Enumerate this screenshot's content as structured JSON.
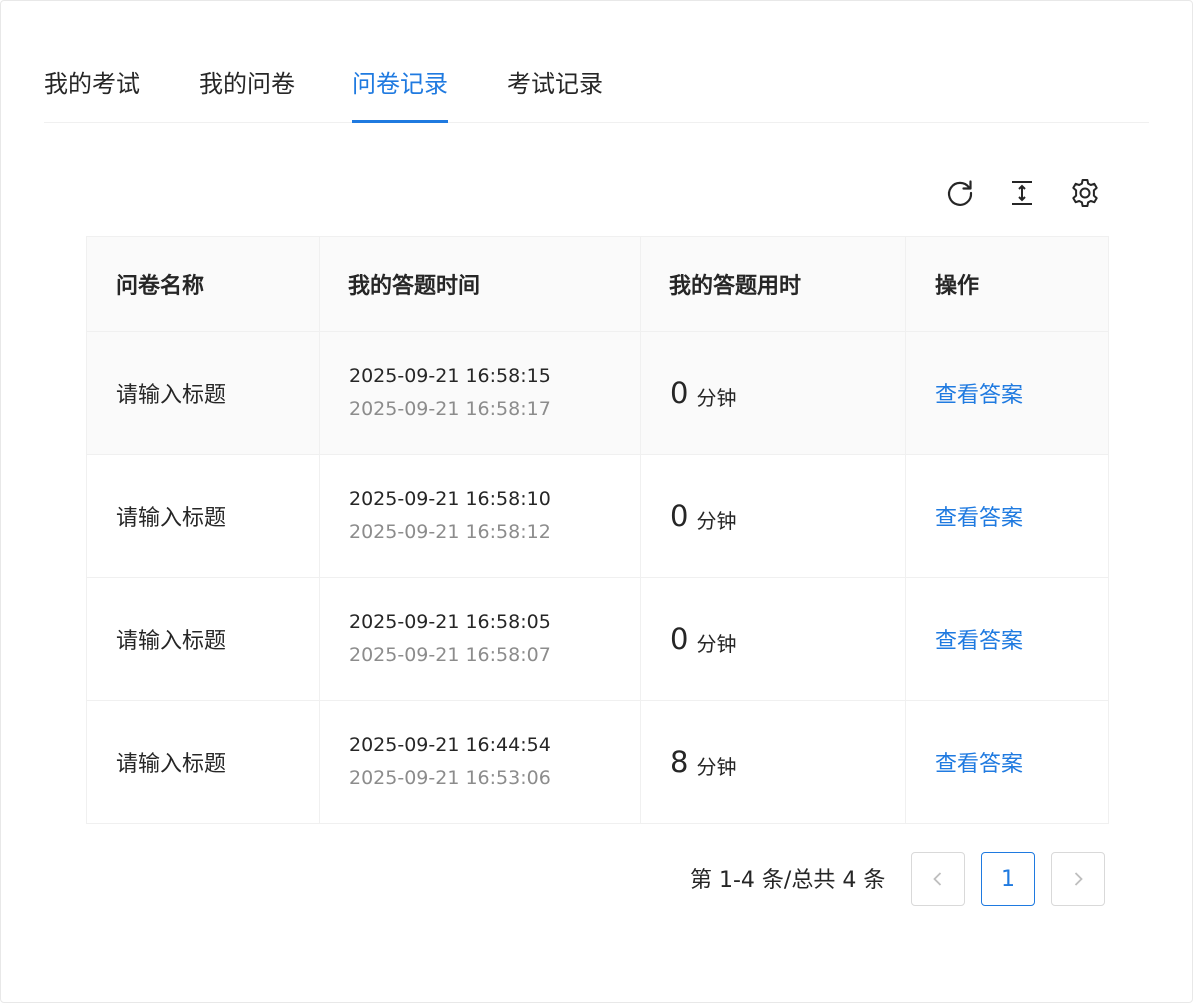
{
  "tabs": [
    {
      "label": "我的考试",
      "active": false
    },
    {
      "label": "我的问卷",
      "active": false
    },
    {
      "label": "问卷记录",
      "active": true
    },
    {
      "label": "考试记录",
      "active": false
    }
  ],
  "toolbar": {
    "refresh_icon": "reload-icon",
    "density_icon": "column-height-icon",
    "settings_icon": "gear-icon"
  },
  "table": {
    "columns": [
      "问卷名称",
      "我的答题时间",
      "我的答题用时",
      "操作"
    ],
    "rows": [
      {
        "name": "请输入标题",
        "start": "2025-09-21 16:58:15",
        "end": "2025-09-21 16:58:17",
        "duration": "0",
        "unit": "分钟",
        "action": "查看答案"
      },
      {
        "name": "请输入标题",
        "start": "2025-09-21 16:58:10",
        "end": "2025-09-21 16:58:12",
        "duration": "0",
        "unit": "分钟",
        "action": "查看答案"
      },
      {
        "name": "请输入标题",
        "start": "2025-09-21 16:58:05",
        "end": "2025-09-21 16:58:07",
        "duration": "0",
        "unit": "分钟",
        "action": "查看答案"
      },
      {
        "name": "请输入标题",
        "start": "2025-09-21 16:44:54",
        "end": "2025-09-21 16:53:06",
        "duration": "8",
        "unit": "分钟",
        "action": "查看答案"
      }
    ]
  },
  "pagination": {
    "total_text": "第 1-4 条/总共 4 条",
    "prev": "<",
    "current": "1",
    "next": ">"
  },
  "colors": {
    "accent": "#1f7ae0",
    "text": "#262626",
    "muted": "#8c8c8c",
    "header_bg": "#fafafa",
    "border": "#f0f0f0"
  }
}
